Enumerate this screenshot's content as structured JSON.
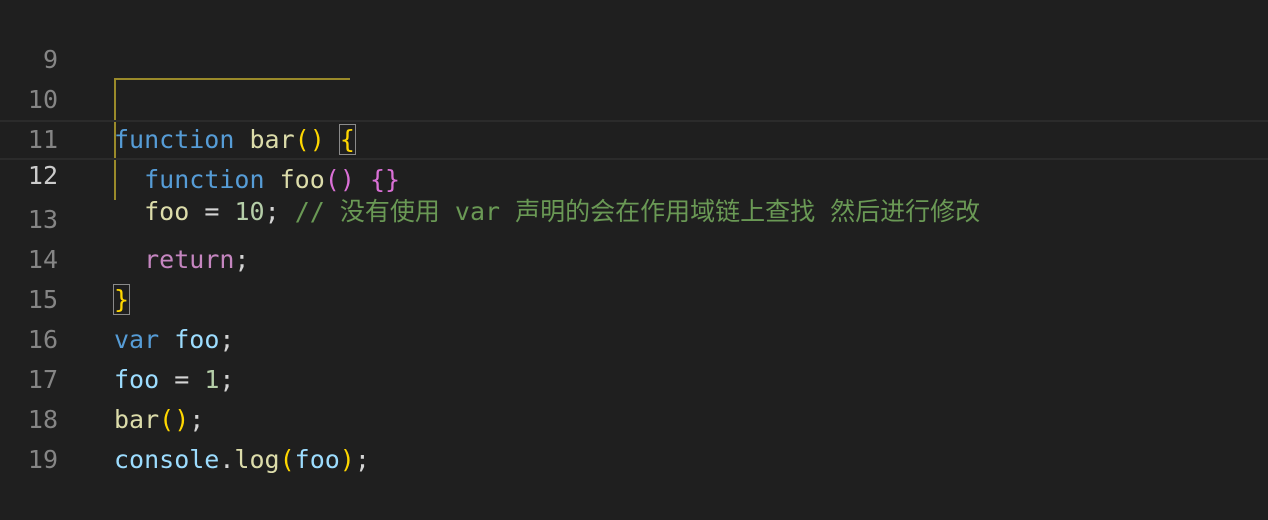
{
  "editor": {
    "lines": [
      {
        "number": "9"
      },
      {
        "number": "10",
        "t": [
          "function",
          "bar",
          "(",
          ")",
          "{"
        ]
      },
      {
        "number": "11",
        "t": [
          "function",
          "foo",
          "(",
          ")",
          "{",
          "}"
        ]
      },
      {
        "number": "12",
        "t": [
          "foo",
          "=",
          "10",
          ";",
          "// 没有使用 var 声明的会在作用域链上查找 然后进行修改"
        ]
      },
      {
        "number": "13",
        "t": [
          "return",
          ";"
        ]
      },
      {
        "number": "14",
        "t": [
          "}"
        ]
      },
      {
        "number": "15",
        "t": [
          "var",
          "foo",
          ";"
        ]
      },
      {
        "number": "16",
        "t": [
          "foo",
          "=",
          "1",
          ";"
        ]
      },
      {
        "number": "17",
        "t": [
          "bar",
          "(",
          ")",
          ";"
        ]
      },
      {
        "number": "18",
        "t": [
          "console",
          ".",
          "log",
          "(",
          "foo",
          ")",
          ";"
        ]
      },
      {
        "number": "19"
      }
    ],
    "current_line": "12"
  },
  "colors": {
    "background": "#1f1f1f",
    "keyword_blue": "#569cd6",
    "keyword_purple": "#c586c0",
    "function_name": "#dcdcaa",
    "variable": "#9cdcfe",
    "number": "#b5cea8",
    "comment": "#6a9955",
    "bracket_level1": "#ffd700",
    "bracket_level2": "#da70d6"
  }
}
